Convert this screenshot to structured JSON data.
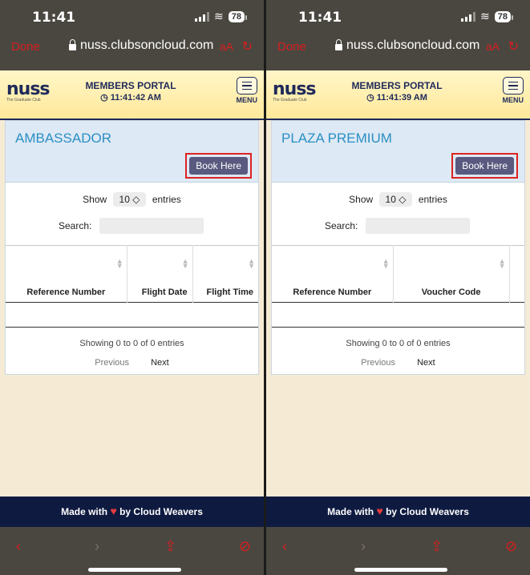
{
  "screens": [
    {
      "status": {
        "time": "11:41",
        "battery": "78"
      },
      "browser": {
        "done": "Done",
        "url": "nuss.clubsoncloud.com",
        "aa": "aA"
      },
      "header": {
        "logo": "nuss",
        "logo_sub": "The Graduate Club",
        "portal_title": "MEMBERS PORTAL",
        "portal_time": "◷ 11:41:42 AM",
        "menu": "MENU"
      },
      "card": {
        "title": "AMBASSADOR",
        "book_label": "Book Here",
        "show": "Show",
        "entries_value": "10",
        "entries": "entries",
        "search": "Search:",
        "columns": [
          "Reference Number",
          "Flight Date",
          "Flight Time"
        ],
        "info": "Showing 0 to 0 of 0 entries",
        "prev": "Previous",
        "next": "Next"
      },
      "footer": {
        "made_with": "Made with",
        "by": "by Cloud Weavers"
      }
    },
    {
      "status": {
        "time": "11:41",
        "battery": "78"
      },
      "browser": {
        "done": "Done",
        "url": "nuss.clubsoncloud.com",
        "aa": "aA"
      },
      "header": {
        "logo": "nuss",
        "logo_sub": "The Graduate Club",
        "portal_title": "MEMBERS PORTAL",
        "portal_time": "◷ 11:41:39 AM",
        "menu": "MENU"
      },
      "card": {
        "title": "PLAZA PREMIUM",
        "book_label": "Book Here",
        "show": "Show",
        "entries_value": "10",
        "entries": "entries",
        "search": "Search:",
        "columns": [
          "Reference Number",
          "Voucher Code"
        ],
        "info": "Showing 0 to 0 of 0 entries",
        "prev": "Previous",
        "next": "Next"
      },
      "footer": {
        "made_with": "Made with",
        "by": "by Cloud Weavers"
      }
    }
  ]
}
